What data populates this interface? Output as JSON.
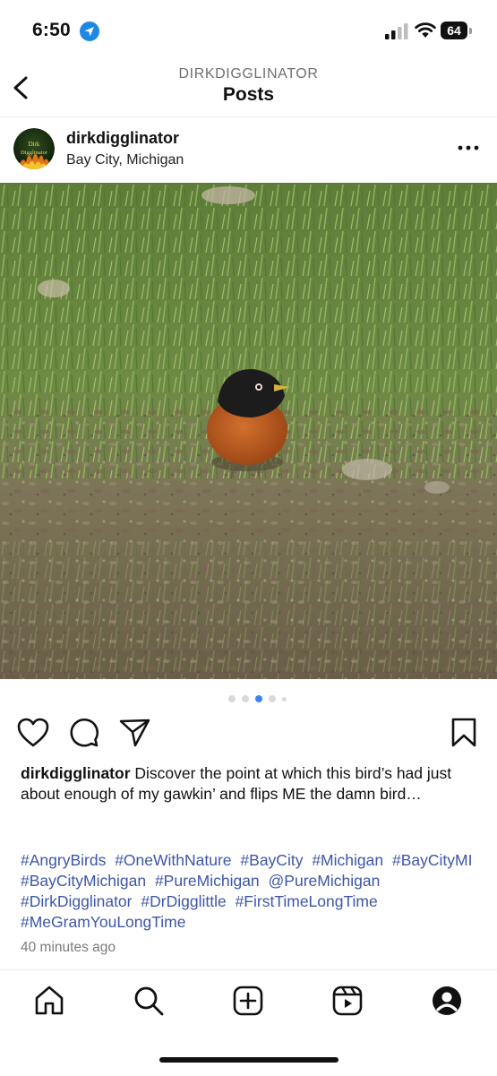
{
  "status_bar": {
    "time": "6:50",
    "battery": "64"
  },
  "header": {
    "username": "DIRKDIGGLINATOR",
    "title": "Posts"
  },
  "post": {
    "username": "dirkdigglinator",
    "location": "Bay City, Michigan",
    "avatar_text": [
      "Dirk",
      "Digglinator"
    ],
    "carousel": {
      "count": 5,
      "active_index": 2
    },
    "caption_user": "dirkdigglinator",
    "caption_text": "Discover the point at which this bird’s had just about enough of my gawkin’ and flips ME the damn bird…",
    "hashtags": [
      "#AngryBirds",
      "#OneWithNature",
      "#BayCity",
      "#Michigan",
      "#BayCityMI",
      "#BayCityMichigan",
      "#PureMichigan",
      "@PureMichigan",
      "#DirkDigglinator",
      "#DrDigglittle",
      "#FirstTimeLongTime",
      "#MeGramYouLongTime"
    ],
    "timestamp": "40 minutes ago"
  },
  "icons": {
    "back": "back-chevron-icon",
    "more": "more-options-icon",
    "like": "heart-icon",
    "comment": "comment-icon",
    "share": "paper-plane-icon",
    "save": "bookmark-icon",
    "nav": [
      "home-icon",
      "search-icon",
      "create-icon",
      "reels-icon",
      "profile-icon"
    ]
  },
  "colors": {
    "link": "#3d56a8",
    "active_dot": "#3b82f6",
    "location_arrow": "#1e88e5"
  }
}
